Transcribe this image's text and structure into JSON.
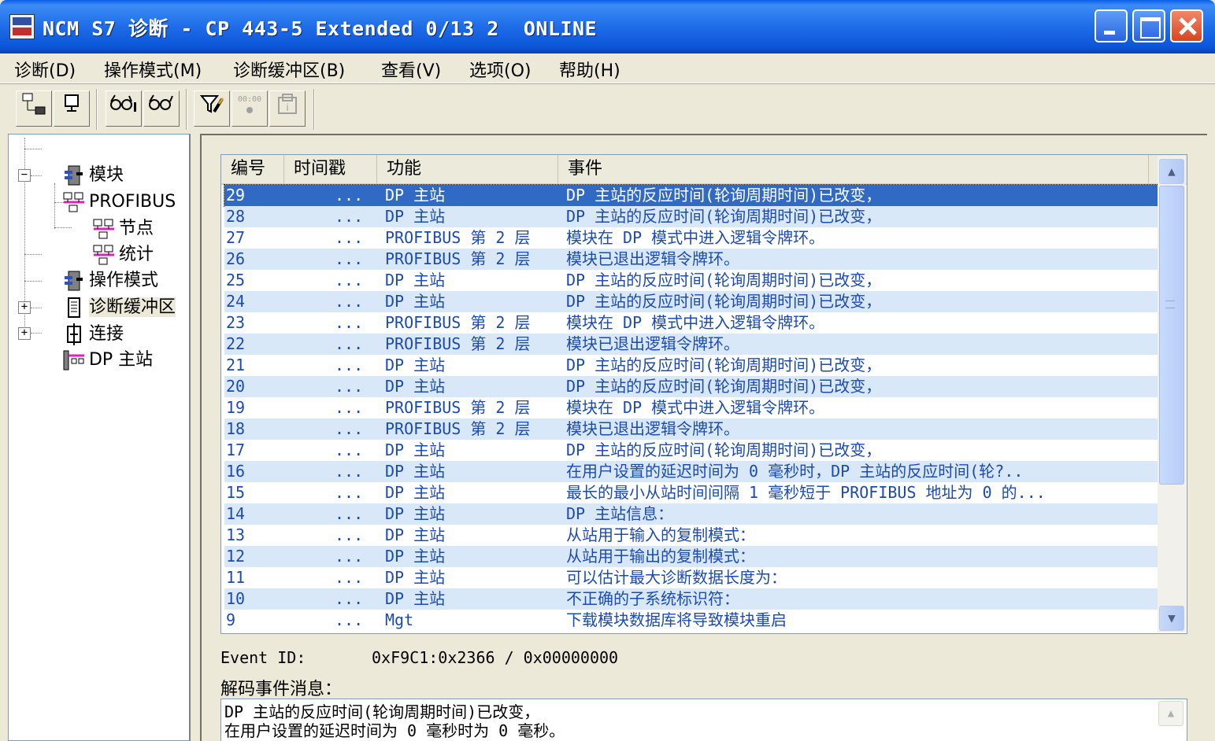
{
  "window": {
    "title": "NCM S7 诊断 - CP 443-5 Extended 0/13 2  ONLINE"
  },
  "menu": [
    {
      "label": "诊断(D)"
    },
    {
      "label": "操作模式(M)"
    },
    {
      "label": "诊断缓冲区(B)"
    },
    {
      "label": "查看(V)"
    },
    {
      "label": "选项(O)"
    },
    {
      "label": "帮助(H)"
    }
  ],
  "toolbar": {
    "buttons": [
      {
        "icon": "network-node-icon"
      },
      {
        "icon": "monitor-icon"
      },
      {
        "icon": "glasses-info-icon"
      },
      {
        "icon": "glasses-icon"
      },
      {
        "icon": "filter-icon"
      },
      {
        "icon": "counter-icon",
        "text": "00:00",
        "disabled": true
      },
      {
        "icon": "print-icon",
        "disabled": true
      }
    ]
  },
  "tree": [
    {
      "label": "模块",
      "icon": "module-icon",
      "expander": null
    },
    {
      "label": "PROFIBUS",
      "icon": "network-icon",
      "expander": "−"
    },
    {
      "label": "节点",
      "icon": "network-icon",
      "expander": null
    },
    {
      "label": "统计",
      "icon": "network-icon",
      "expander": null
    },
    {
      "label": "操作模式",
      "icon": "module-icon",
      "expander": null
    },
    {
      "label": "诊断缓冲区",
      "icon": "buffer-icon",
      "expander": null,
      "selected": true
    },
    {
      "label": "连接",
      "icon": "connection-icon",
      "expander": "+"
    },
    {
      "label": "DP 主站",
      "icon": "dp-master-icon",
      "expander": "+"
    }
  ],
  "list": {
    "columns": [
      "编号",
      "时间戳",
      "功能",
      "事件"
    ],
    "rows": [
      {
        "no": "29",
        "time": "...",
        "func": "DP 主站",
        "event": "DP 主站的反应时间(轮询周期时间)已改变，"
      },
      {
        "no": "28",
        "time": "...",
        "func": "DP 主站",
        "event": "DP 主站的反应时间(轮询周期时间)已改变，"
      },
      {
        "no": "27",
        "time": "...",
        "func": "PROFIBUS 第 2 层",
        "event": "模块在 DP 模式中进入逻辑令牌环。"
      },
      {
        "no": "26",
        "time": "...",
        "func": "PROFIBUS 第 2 层",
        "event": "模块已退出逻辑令牌环。"
      },
      {
        "no": "25",
        "time": "...",
        "func": "DP 主站",
        "event": "DP 主站的反应时间(轮询周期时间)已改变，"
      },
      {
        "no": "24",
        "time": "...",
        "func": "DP 主站",
        "event": "DP 主站的反应时间(轮询周期时间)已改变，"
      },
      {
        "no": "23",
        "time": "...",
        "func": "PROFIBUS 第 2 层",
        "event": "模块在 DP 模式中进入逻辑令牌环。"
      },
      {
        "no": "22",
        "time": "...",
        "func": "PROFIBUS 第 2 层",
        "event": "模块已退出逻辑令牌环。"
      },
      {
        "no": "21",
        "time": "...",
        "func": "DP 主站",
        "event": "DP 主站的反应时间(轮询周期时间)已改变，"
      },
      {
        "no": "20",
        "time": "...",
        "func": "DP 主站",
        "event": "DP 主站的反应时间(轮询周期时间)已改变，"
      },
      {
        "no": "19",
        "time": "...",
        "func": "PROFIBUS 第 2 层",
        "event": "模块在 DP 模式中进入逻辑令牌环。"
      },
      {
        "no": "18",
        "time": "...",
        "func": "PROFIBUS 第 2 层",
        "event": "模块已退出逻辑令牌环。"
      },
      {
        "no": "17",
        "time": "...",
        "func": "DP 主站",
        "event": "DP 主站的反应时间(轮询周期时间)已改变，"
      },
      {
        "no": "16",
        "time": "...",
        "func": "DP 主站",
        "event": "在用户设置的延迟时间为 0 毫秒时，DP 主站的反应时间(轮?.."
      },
      {
        "no": "15",
        "time": "...",
        "func": "DP 主站",
        "event": "最长的最小从站时间间隔 1 毫秒短于 PROFIBUS 地址为 0 的..."
      },
      {
        "no": "14",
        "time": "...",
        "func": "DP 主站",
        "event": "DP 主站信息："
      },
      {
        "no": "13",
        "time": "...",
        "func": "DP 主站",
        "event": "从站用于输入的复制模式："
      },
      {
        "no": "12",
        "time": "...",
        "func": "DP 主站",
        "event": "从站用于输出的复制模式："
      },
      {
        "no": "11",
        "time": "...",
        "func": "DP 主站",
        "event": "可以估计最大诊断数据长度为："
      },
      {
        "no": "10",
        "time": "...",
        "func": "DP 主站",
        "event": "不正确的子系统标识符："
      },
      {
        "no": "9",
        "time": "...",
        "func": "Mgt",
        "event": "下载模块数据库将导致模块重启"
      }
    ]
  },
  "event": {
    "id_label": "Event ID:",
    "id_value": "0xF9C1:0x2366 / 0x00000000",
    "decode_label": "解码事件消息：",
    "decode_lines": [
      "DP 主站的反应时间(轮询周期时间)已改变，",
      "在用户设置的延迟时间为 0 毫秒时为 0 毫秒。"
    ]
  }
}
